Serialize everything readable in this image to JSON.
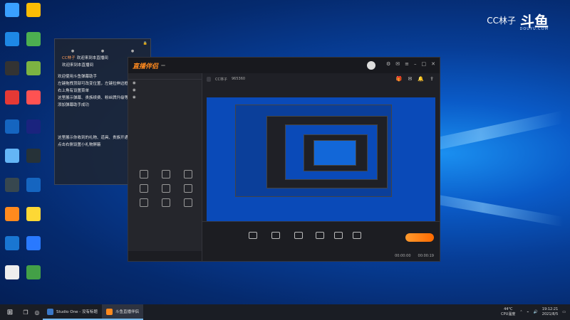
{
  "desktop": {
    "icons_col1": [
      "",
      "",
      "",
      "",
      "",
      "",
      "",
      "",
      "",
      ""
    ],
    "icons_col2": [
      "",
      "",
      "",
      "",
      "",
      "",
      "",
      "",
      "",
      ""
    ]
  },
  "watermark": {
    "streamer": "CC林子",
    "brand_mark": "斗鱼",
    "brand_sub": "DOUYU.COM"
  },
  "chat": {
    "lines": [
      {
        "tag": "",
        "nick": "CC林子",
        "text": "欢迎来到本直播间",
        "tag_color": "#ff7a1a"
      },
      {
        "tag": "",
        "nick": "",
        "text": "欢迎来到本直播间",
        "tag_color": "#e9463a"
      },
      {
        "text": "欢迎使用斗鱼弹幕助手"
      },
      {
        "text": "左键拖拽顶部可改变位置，左键拉伸边框改变大小"
      },
      {
        "text": "右上角有设置菜单"
      },
      {
        "text": "这里展示弹幕、贵族续费、粉丝牌升级等"
      },
      {
        "text": "添加弹幕助手成功"
      },
      {
        "text": "这里展示你收到的礼物、道具、贵族开通"
      },
      {
        "text": "点击右侧设置小礼物屏蔽"
      }
    ]
  },
  "app": {
    "title": "直播伴侣",
    "badge": "",
    "left_tabs": [
      "",
      "",
      ""
    ],
    "active_tab_index": 0,
    "room_title": "",
    "room_chip": "",
    "meta": {
      "category": "",
      "streamer": "CC林子",
      "room_id": "965360"
    },
    "tools": [
      {
        "label": ""
      },
      {
        "label": ""
      },
      {
        "label": ""
      },
      {
        "label": ""
      },
      {
        "label": ""
      },
      {
        "label": ""
      },
      {
        "label": ""
      },
      {
        "label": ""
      },
      {
        "label": ""
      }
    ],
    "notice": "",
    "controls": [
      {
        "label": "",
        "x": 0
      },
      {
        "label": "",
        "x": 0
      },
      {
        "label": "",
        "x": 0
      },
      {
        "label": "",
        "x": 0
      },
      {
        "label": "",
        "x": 0
      },
      {
        "label": "",
        "x": 0
      }
    ],
    "go_live_label": "",
    "timer_1": "00:00:00",
    "timer_2": "00:00:19"
  },
  "taskbar": {
    "apps": [
      {
        "label": "Studio One - 没有标题",
        "color": "#3a78c8"
      },
      {
        "label": "斗鱼直播伴侣",
        "color": "#ff8a1e"
      }
    ],
    "temp": "44°C",
    "temp_label": "CPU温度",
    "time": "19:12:21",
    "date": "2021/8/5"
  }
}
